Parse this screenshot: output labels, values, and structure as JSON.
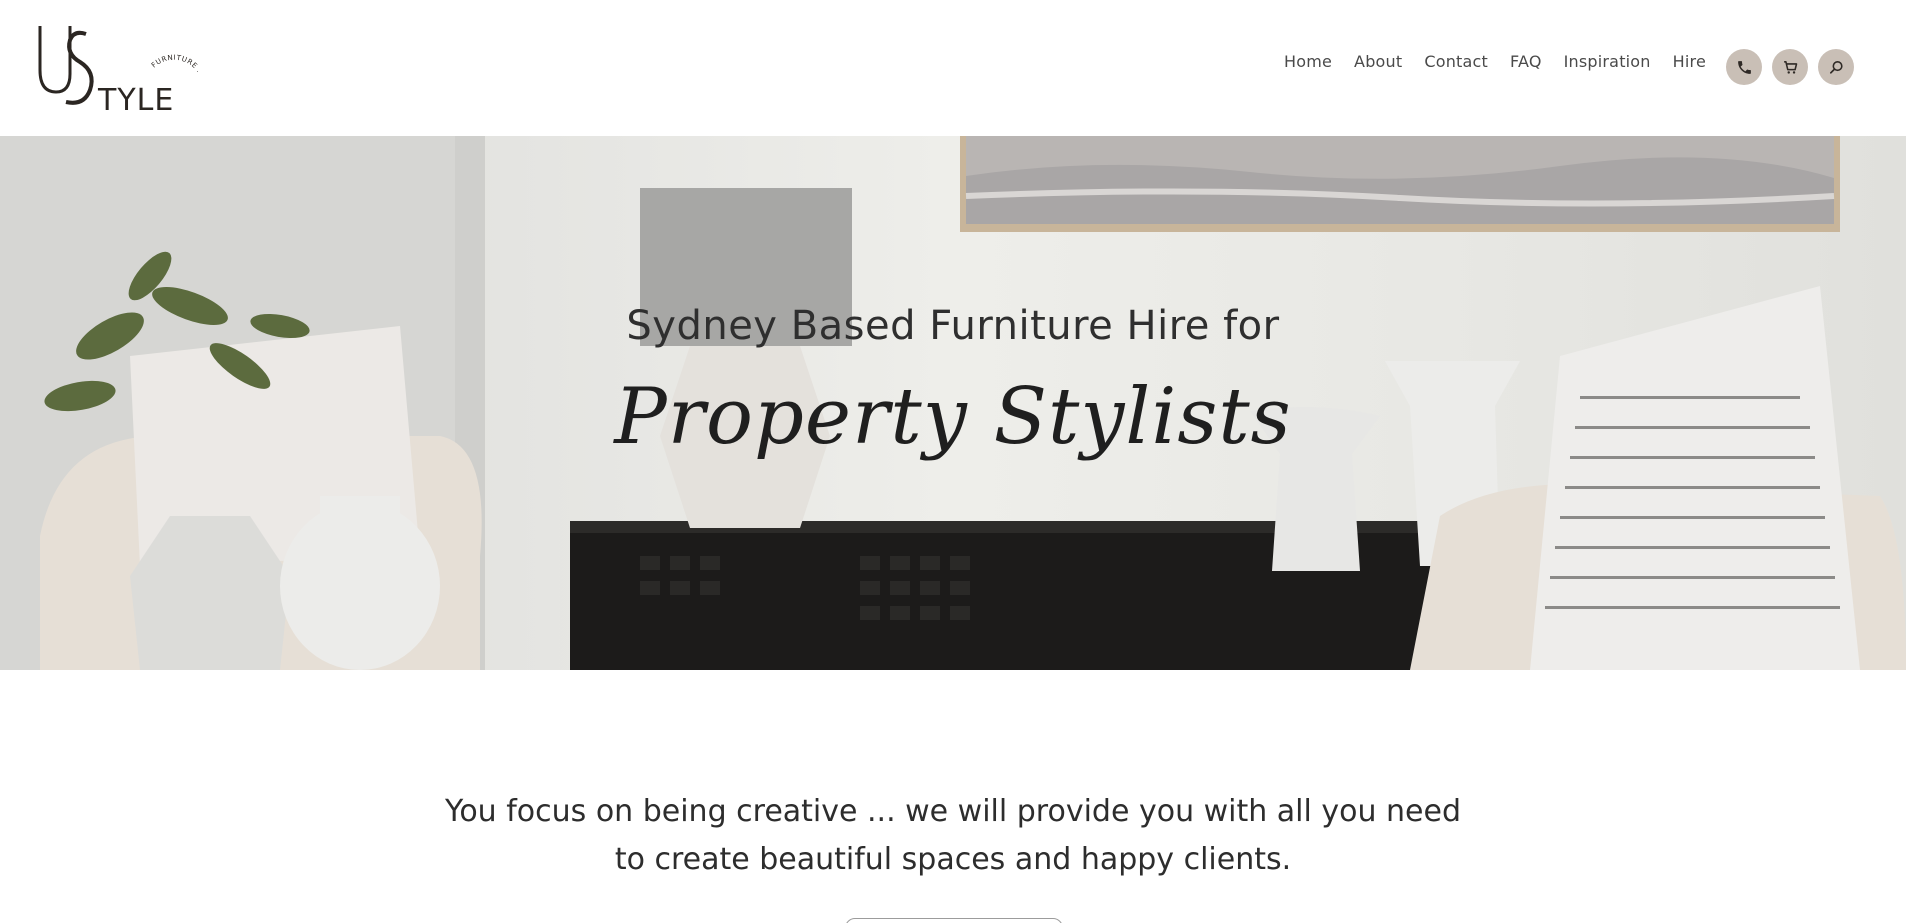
{
  "brand": {
    "logo_letters": "US",
    "logo_wordmark": "TYLE",
    "logo_tagline": "FURNITURE HIRE"
  },
  "nav": {
    "items": [
      {
        "label": "Home"
      },
      {
        "label": "About"
      },
      {
        "label": "Contact"
      },
      {
        "label": "FAQ"
      },
      {
        "label": "Inspiration"
      },
      {
        "label": "Hire"
      }
    ]
  },
  "header_icons": [
    {
      "icon": "phone-icon"
    },
    {
      "icon": "cart-icon"
    },
    {
      "icon": "search-icon"
    }
  ],
  "hero": {
    "subtitle": "Sydney Based Furniture Hire for",
    "title": "Property Stylists"
  },
  "intro": {
    "line1": "You focus on being creative ... we will provide you with all you need",
    "line2": "to create beautiful spaces and happy clients."
  },
  "colors": {
    "icon_button_bg": "#c9bfb6",
    "text_dark": "#2d2d2d",
    "nav_text": "#4a4a4a"
  }
}
